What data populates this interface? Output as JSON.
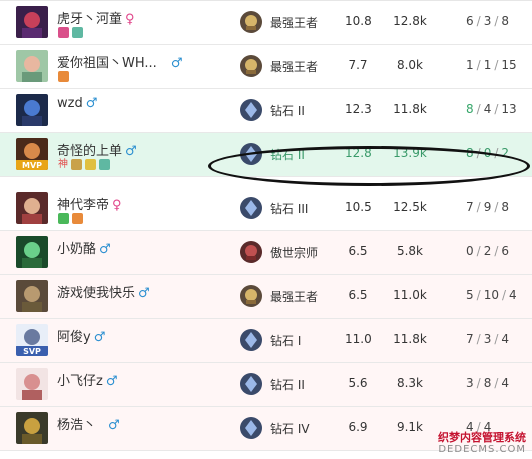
{
  "players": [
    {
      "name": "虎牙丶河童",
      "gender": "♀",
      "tier": "最强王者",
      "tier_kind": "master",
      "kda": "10.8",
      "dmg": "12.8k",
      "score": [
        "6",
        "3",
        "8"
      ],
      "highlight": "",
      "badge": ""
    },
    {
      "name": "爱你祖国丶WH...",
      "gender": "♂",
      "tier": "最强王者",
      "tier_kind": "master",
      "kda": "7.7",
      "dmg": "8.0k",
      "score": [
        "1",
        "1",
        "15"
      ],
      "highlight": "",
      "badge": ""
    },
    {
      "name": "wzd",
      "gender": "♂",
      "tier": "钻石 II",
      "tier_kind": "diamond",
      "kda": "12.3",
      "dmg": "11.8k",
      "score": [
        "8",
        "4",
        "13"
      ],
      "highlight": "green-first",
      "badge": ""
    },
    {
      "name": "奇怪的上单",
      "gender": "♂",
      "tier": "钻石 II",
      "tier_kind": "diamond",
      "kda": "12.8",
      "dmg": "13.9k",
      "score": [
        "8",
        "0",
        "2"
      ],
      "highlight": "mvp",
      "badge": "MVP",
      "tag_text": "神"
    },
    {
      "name": "神代李帝",
      "gender": "♀",
      "tier": "钻石 III",
      "tier_kind": "diamond",
      "kda": "10.5",
      "dmg": "12.5k",
      "score": [
        "7",
        "9",
        "8"
      ],
      "highlight": "",
      "badge": ""
    },
    {
      "name": "小奶酪",
      "gender": "♂",
      "tier": "傲世宗师",
      "tier_kind": "grandmaster",
      "kda": "6.5",
      "dmg": "5.8k",
      "score": [
        "0",
        "2",
        "6"
      ],
      "highlight": "",
      "badge": ""
    },
    {
      "name": "游戏使我快乐",
      "gender": "♂",
      "tier": "最强王者",
      "tier_kind": "master",
      "kda": "6.5",
      "dmg": "11.0k",
      "score": [
        "5",
        "10",
        "4"
      ],
      "highlight": "",
      "badge": ""
    },
    {
      "name": "阿俊y",
      "gender": "♂",
      "tier": "钻石 I",
      "tier_kind": "diamond",
      "kda": "11.0",
      "dmg": "11.8k",
      "score": [
        "7",
        "3",
        "4"
      ],
      "highlight": "",
      "badge": "SVP"
    },
    {
      "name": "小飞仔z",
      "gender": "♂",
      "tier": "钻石 II",
      "tier_kind": "diamond",
      "kda": "5.6",
      "dmg": "8.3k",
      "score": [
        "3",
        "8",
        "4"
      ],
      "highlight": "",
      "badge": ""
    },
    {
      "name": "杨浩丶",
      "gender": "♂",
      "tier": "钻石 IV",
      "tier_kind": "diamond",
      "kda": "6.9",
      "dmg": "9.1k",
      "score": [
        "4",
        "",
        "4"
      ],
      "highlight": "",
      "badge": ""
    }
  ],
  "watermark": {
    "line1": "织梦内容管理系统",
    "line2": "DEDECMS.COM"
  },
  "colors": {
    "mvp_row": "#e3f7ec",
    "red_team_row": "#fff6f6",
    "male": "#2b8fd0",
    "female": "#e0458a",
    "highlight_green": "#36a66a"
  }
}
